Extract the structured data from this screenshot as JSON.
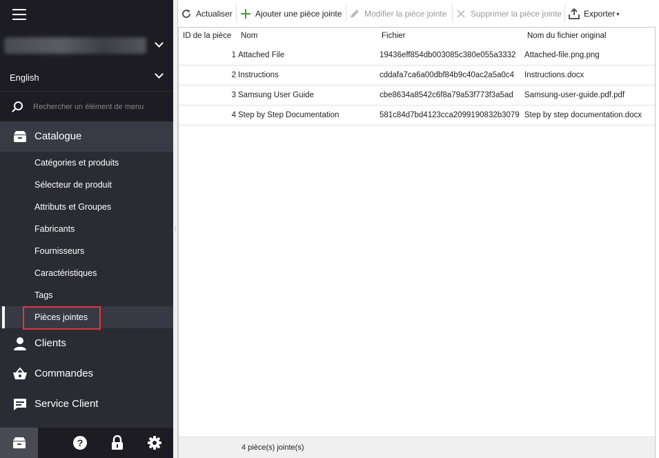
{
  "sidebar": {
    "language": "English",
    "search_placeholder": "Rechercher un élément de menu",
    "catalog_label": "Catalogue",
    "catalog_items": [
      {
        "label": "Catégories et produits"
      },
      {
        "label": "Sélecteur de produit"
      },
      {
        "label": "Attributs et Groupes"
      },
      {
        "label": "Fabricants"
      },
      {
        "label": "Fournisseurs"
      },
      {
        "label": "Caractéristiques"
      },
      {
        "label": "Tags"
      },
      {
        "label": "Pièces jointes",
        "active": true
      }
    ],
    "sections": [
      {
        "label": "Clients",
        "icon": "user-icon"
      },
      {
        "label": "Commandes",
        "icon": "basket-icon"
      },
      {
        "label": "Service Client",
        "icon": "chat-icon"
      }
    ],
    "bottom_icons": [
      "catalog-icon",
      "help-icon",
      "lock-icon",
      "gear-icon"
    ]
  },
  "toolbar": {
    "refresh": "Actualiser",
    "add": "Ajouter une pièce jointe",
    "edit": "Modifier la pièce jointe",
    "delete": "Supprimer la pièce jointe",
    "export": "Exporter"
  },
  "grid": {
    "columns": [
      "ID de la pièce",
      "Nom",
      "Fichier",
      "Nom du fichier original"
    ],
    "rows": [
      {
        "id": "1",
        "name": "Attached File",
        "file": "19436eff854db003085c380e055a3332",
        "original": "Attached-file.png.png"
      },
      {
        "id": "2",
        "name": "Instructions",
        "file": "cddafa7ca6a00dbf84b9c40ac2a5a0c4",
        "original": "Instructions.docx"
      },
      {
        "id": "3",
        "name": "Samsung User Guide",
        "file": "cbe8634a8542c6f8a79a53f773f3a5ad",
        "original": "Samsung-user-guide.pdf.pdf"
      },
      {
        "id": "4",
        "name": "Step by Step Documentation",
        "file": "581c84d7bd4123cca2099190832b3079",
        "original": "Step by step documentation.docx"
      }
    ],
    "footer": "4 pièce(s) jointe(s)"
  },
  "colors": {
    "sidebar_bg": "#2b2b33",
    "sidebar_dark": "#1c1c22",
    "highlight": "#e0393f",
    "add_icon": "#3aa13a"
  }
}
